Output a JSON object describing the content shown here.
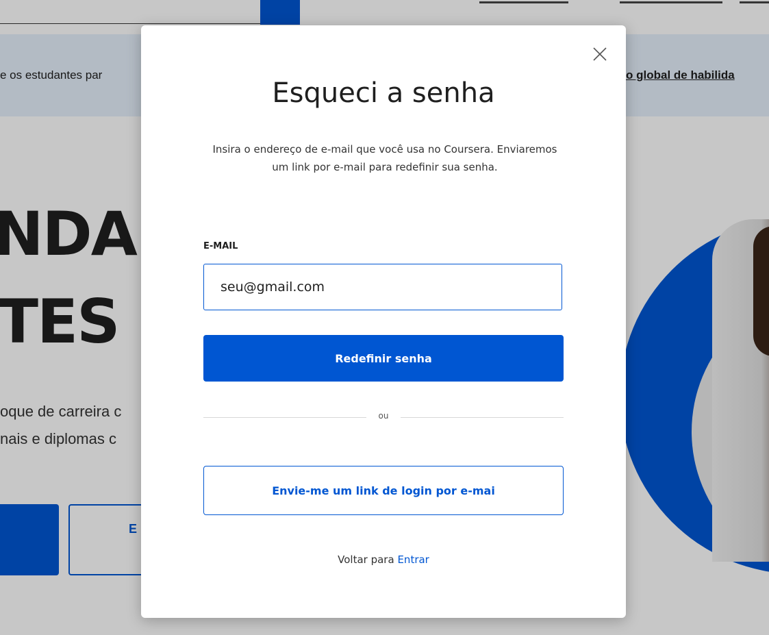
{
  "background": {
    "banner_left_text": "e os estudantes par",
    "banner_right_text": "o global de habilida",
    "hero_line_1": "NDA",
    "hero_line_2": "TES",
    "subtitle_line_1": "oque de carreira c",
    "subtitle_line_2": "nais e diplomas c",
    "outline_button_label": "E"
  },
  "modal": {
    "title": "Esqueci a senha",
    "description": "Insira o endereço de e-mail que você usa no Coursera. Enviaremos um link por e-mail para redefinir sua senha.",
    "email_label": "E-MAIL",
    "email_value": "seu@gmail.com",
    "submit_label": "Redefinir senha",
    "divider_text": "ou",
    "magic_link_label": "Envie-me um link de login por e-mai",
    "back_prefix": "Voltar para",
    "back_link": "Entrar"
  },
  "colors": {
    "accent": "#0056d2",
    "overlay": "rgba(0,0,0,0.22)"
  },
  "icons": {
    "close": "close-icon"
  }
}
